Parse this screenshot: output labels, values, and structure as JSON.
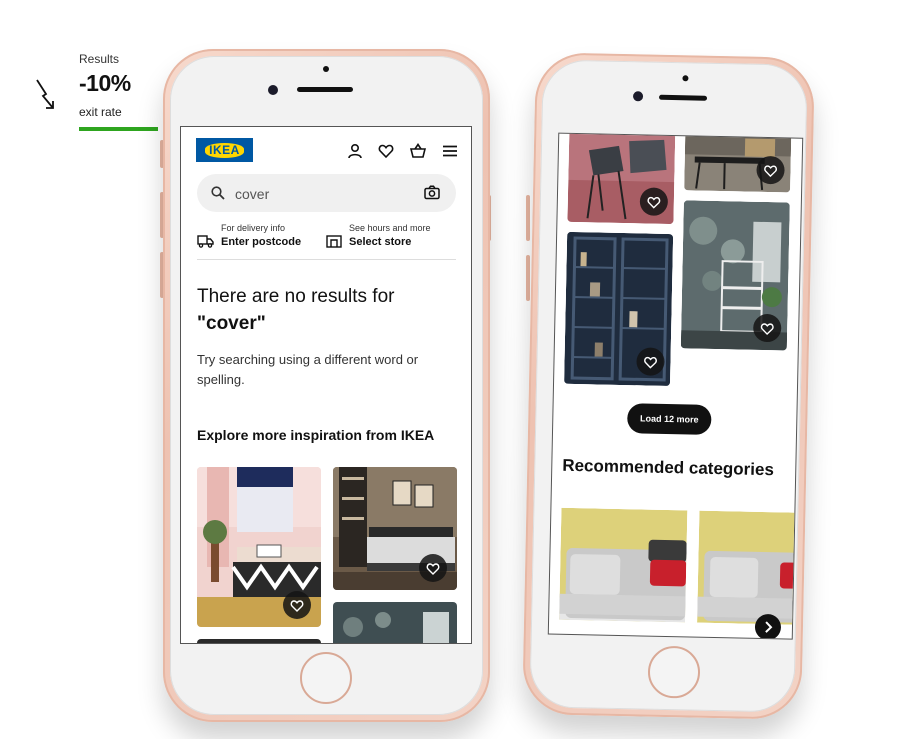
{
  "stat": {
    "label": "Results",
    "value": "-10%",
    "sublabel": "exit rate",
    "accent_color": "#2ea51f",
    "trend_icon": "arrow-down-right-icon"
  },
  "phone1": {
    "logo": "IKEA",
    "header_icons": [
      "user-icon",
      "heart-icon",
      "basket-icon",
      "menu-icon"
    ],
    "search": {
      "value": "cover",
      "icon": "search-icon",
      "camera_icon": "camera-icon"
    },
    "delivery": {
      "small": "For delivery info",
      "big": "Enter postcode",
      "icon": "truck-icon"
    },
    "store": {
      "small": "See hours and more",
      "big": "Select store",
      "icon": "store-icon"
    },
    "no_results_prefix": "There are no results for",
    "no_results_query": "\"cover\"",
    "tip": "Try searching using a different word or spelling.",
    "explore_title": "Explore more inspiration from IKEA"
  },
  "phone2": {
    "load_more": "Load 12 more",
    "recommended_title": "Recommended categories",
    "next_icon": "chevron-right-icon"
  }
}
